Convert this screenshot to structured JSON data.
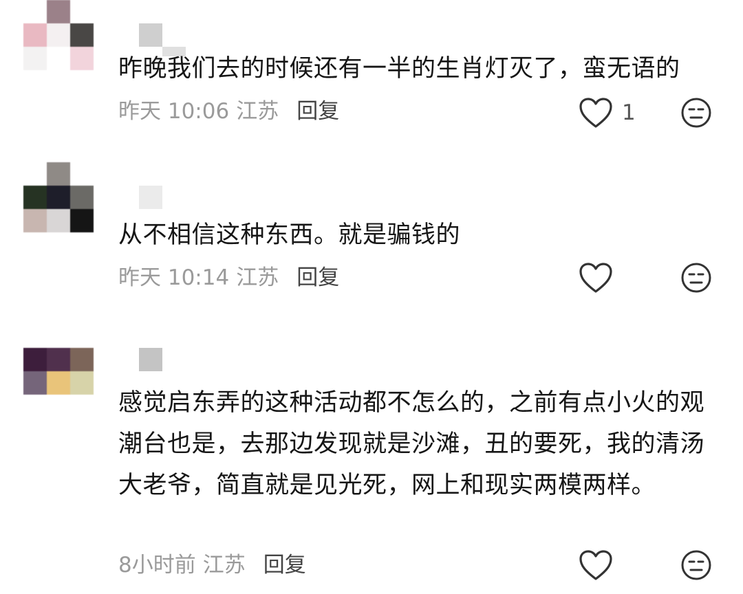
{
  "comments": [
    {
      "text": "昨晚我们去的时候还有一半的生肖灯灭了，蛮无语的",
      "time": "昨天 10:06",
      "location": "江苏",
      "reply": "回复",
      "likes": "1"
    },
    {
      "text": "从不相信这种东西。就是骗钱的",
      "time": "昨天 10:14",
      "location": "江苏",
      "reply": "回复",
      "likes": ""
    },
    {
      "text": "感觉启东弄的这种活动都不怎么的，之前有点小火的观潮台也是，去那边发现就是沙滩，丑的要死，我的清汤大老爷，简直就是见光死，网上和现实两模两样。",
      "time": "8小时前",
      "location": "江苏",
      "reply": "回复",
      "likes": ""
    }
  ],
  "icons": {
    "like": "heart-outline-icon",
    "dislike": "neutral-face-icon"
  },
  "colors": {
    "text": "#161616",
    "meta": "#9a9a9a",
    "reply": "#444444",
    "icon": "#333333"
  }
}
